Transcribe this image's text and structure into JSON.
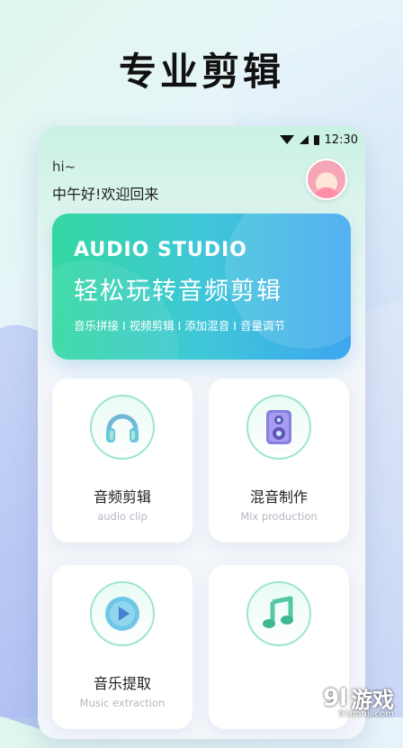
{
  "headline": "专业剪辑",
  "status": {
    "time": "12:30"
  },
  "greeting": {
    "hi": "hi~",
    "message": "中午好!欢迎回来"
  },
  "banner": {
    "title": "AUDIO STUDIO",
    "subtitle": "轻松玩转音频剪辑",
    "tags": "音乐拼接 I 视频剪辑 I 添加混音 I 音量调节"
  },
  "cards": [
    {
      "title": "音频剪辑",
      "sub": "audio clip",
      "icon": "headphones-icon"
    },
    {
      "title": "混音制作",
      "sub": "Mix production",
      "icon": "speaker-icon"
    },
    {
      "title": "音乐提取",
      "sub": "Music extraction",
      "icon": "play-icon"
    },
    {
      "title": "",
      "sub": "",
      "icon": "music-note-icon"
    }
  ],
  "watermark": {
    "mark": "9l",
    "text": "游戏",
    "url": "91danji.com"
  },
  "colors": {
    "accent": "#3fc7d8",
    "green": "#33d8a1",
    "blue": "#3ea6f0"
  }
}
